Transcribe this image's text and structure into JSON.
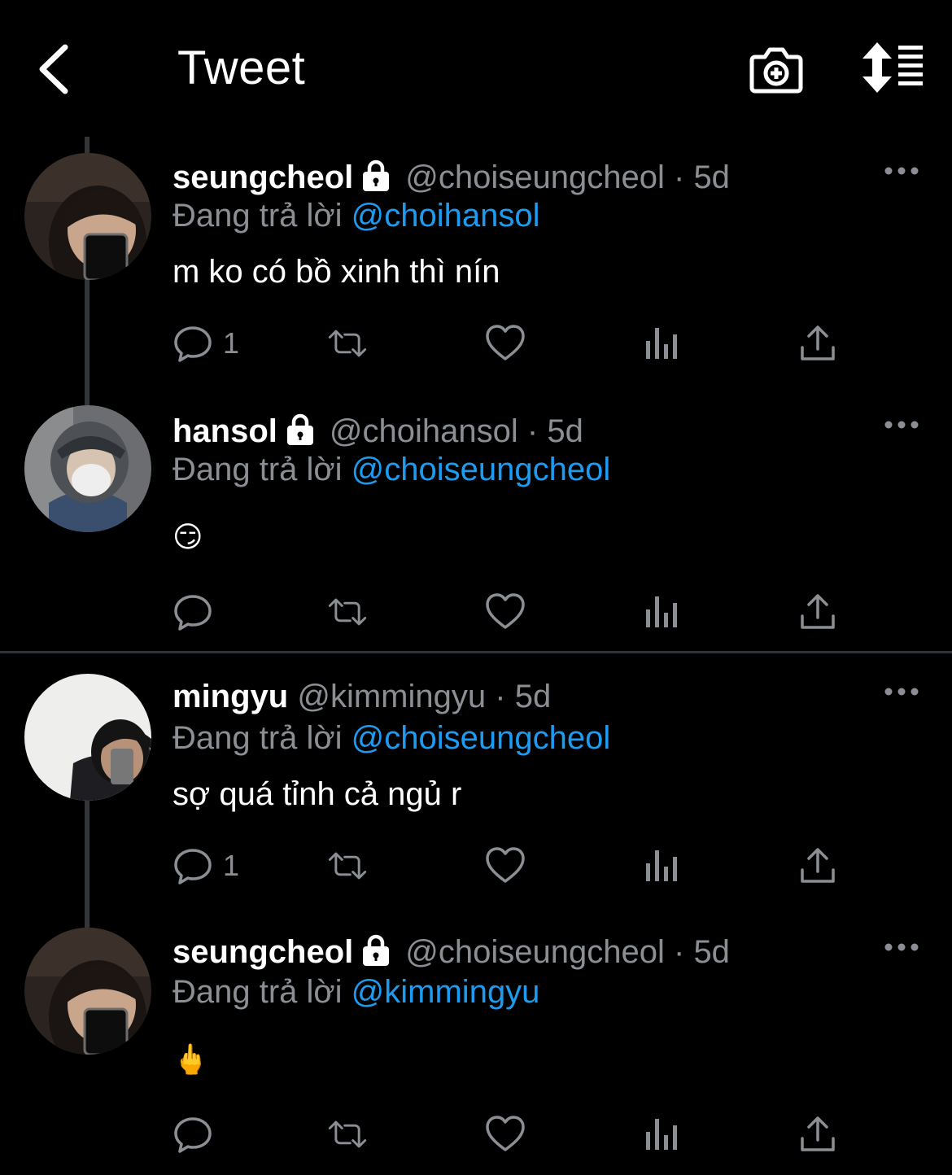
{
  "header": {
    "title": "Tweet",
    "back_icon": "chevron-left-icon",
    "camera_icon": "camera-plus-icon",
    "sort_icon": "sort-icon"
  },
  "colors": {
    "background": "#000000",
    "accent": "#1d9bf0",
    "muted": "#8b8f94",
    "text": "#ffffff"
  },
  "tweets": [
    {
      "name": "seungcheol",
      "protected": true,
      "handle": "@choiseungcheol",
      "dot": "·",
      "time": "5d",
      "reply_prefix": "Đang trả lời",
      "reply_to": "@choihansol",
      "text": "m ko có bồ xinh thì nín",
      "reply_count": "1"
    },
    {
      "name": "hansol",
      "protected": true,
      "handle": "@choihansol",
      "dot": "·",
      "time": "5d",
      "reply_prefix": "Đang trả lời",
      "reply_to": "@choiseungcheol",
      "text": "😏",
      "reply_count": ""
    },
    {
      "name": "mingyu",
      "protected": false,
      "handle": "@kimmingyu",
      "dot": "·",
      "time": "5d",
      "reply_prefix": "Đang trả lời",
      "reply_to": "@choiseungcheol",
      "text": "sợ quá tỉnh cả ngủ r",
      "reply_count": "1"
    },
    {
      "name": "seungcheol",
      "protected": true,
      "handle": "@choiseungcheol",
      "dot": "·",
      "time": "5d",
      "reply_prefix": "Đang trả lời",
      "reply_to": "@kimmingyu",
      "text": "🖕",
      "reply_count": ""
    }
  ],
  "action_icons": [
    "reply-icon",
    "retweet-icon",
    "like-icon",
    "analytics-icon",
    "share-icon"
  ]
}
